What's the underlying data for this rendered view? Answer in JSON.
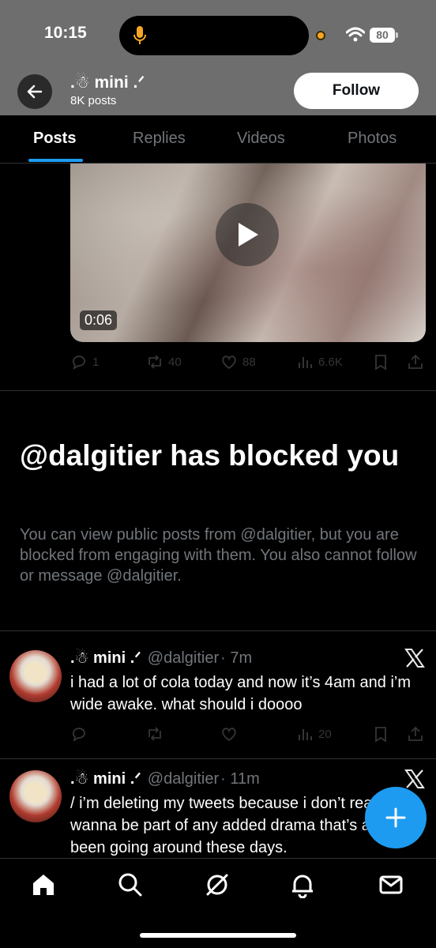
{
  "status_bar": {
    "time": "10:15",
    "battery": "80"
  },
  "header": {
    "profile_name": ".☃ mini .ᐟ",
    "post_count": "8K posts",
    "follow_label": "Follow"
  },
  "tabs": [
    {
      "label": "Posts",
      "active": true
    },
    {
      "label": "Replies",
      "active": false
    },
    {
      "label": "Videos",
      "active": false
    },
    {
      "label": "Photos",
      "active": false
    }
  ],
  "media_post": {
    "duration": "0:06",
    "replies": "1",
    "reposts": "40",
    "likes": "88",
    "views": "6.6K"
  },
  "blocked_notice": {
    "title": "@dalgitier has blocked you",
    "text": "You can view public posts from @dalgitier, but you are blocked from engaging with them. You also cannot follow or message @dalgitier."
  },
  "tweets": [
    {
      "name": ".☃ mini .ᐟ",
      "handle": "@dalgitier",
      "time": "· 7m",
      "text": "i had a lot of cola today and now it’s 4am and i’m wide awake. what should i doooo",
      "views": "20"
    },
    {
      "name": ".☃ mini .ᐟ",
      "handle": "@dalgitier",
      "time": "· 11m",
      "text": "/ i’m deleting my tweets because i don’t really wanna be part of any added drama that’s already been going around these days."
    }
  ],
  "colors": {
    "accent": "#1d9bf0",
    "background": "#000000",
    "muted": "#71767b",
    "header_overlay": "#6e6e6e"
  },
  "icons": [
    "back-arrow-icon",
    "microphone-icon",
    "wifi-icon",
    "play-icon",
    "reply-icon",
    "repost-icon",
    "like-icon",
    "views-icon",
    "bookmark-icon",
    "share-icon",
    "x-logo-icon",
    "compose-icon",
    "home-icon",
    "search-icon",
    "grok-icon",
    "notifications-icon",
    "messages-icon"
  ]
}
